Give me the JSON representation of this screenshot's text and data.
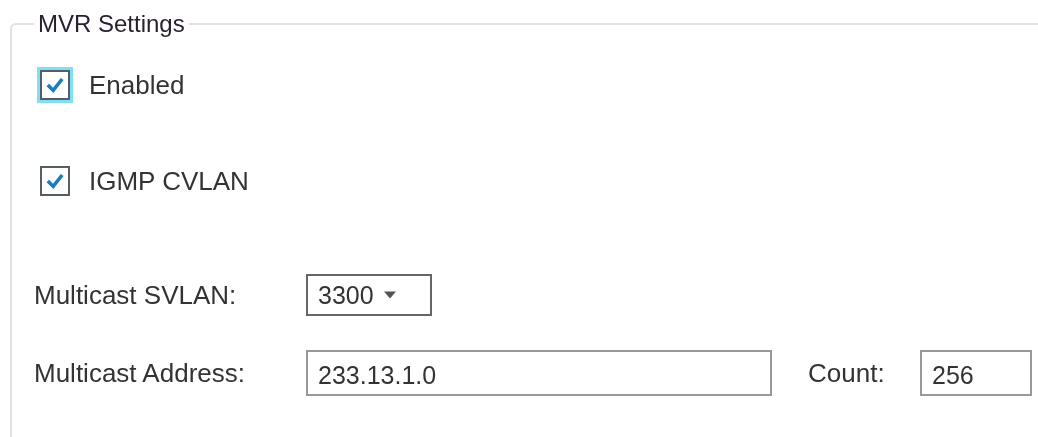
{
  "group": {
    "legend": "MVR Settings"
  },
  "options": [
    {
      "label": "Enabled",
      "checked": true,
      "focused": true
    },
    {
      "label": "IGMP CVLAN",
      "checked": true,
      "focused": false
    }
  ],
  "multicast_svlan": {
    "label": "Multicast SVLAN:",
    "value": "3300"
  },
  "multicast_address": {
    "label": "Multicast Address:",
    "value": "233.13.1.0"
  },
  "count": {
    "label": "Count:",
    "value": "256"
  }
}
